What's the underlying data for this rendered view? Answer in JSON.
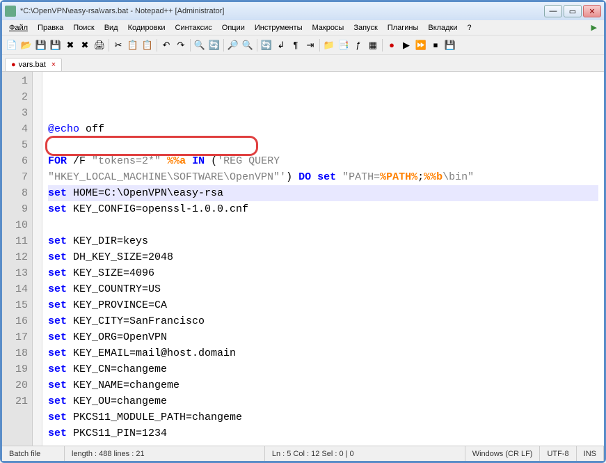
{
  "window": {
    "title": "*C:\\OpenVPN\\easy-rsa\\vars.bat - Notepad++ [Administrator]"
  },
  "menu": {
    "file": "Файл",
    "edit": "Правка",
    "search": "Поиск",
    "view": "Вид",
    "encoding": "Кодировки",
    "syntax": "Синтаксис",
    "options": "Опции",
    "tools": "Инструменты",
    "macros": "Макросы",
    "run": "Запуск",
    "plugins": "Плагины",
    "tabs": "Вкладки",
    "help": "?"
  },
  "tab": {
    "name": "vars.bat"
  },
  "code": {
    "lines": [
      {
        "n": 1,
        "t": "echoOff"
      },
      {
        "n": 2,
        "t": "blank"
      },
      {
        "n": 3,
        "t": "forLine"
      },
      {
        "n": 4,
        "t": "blank2"
      },
      {
        "n": 5,
        "t": "setHome",
        "hl": true
      },
      {
        "n": 6,
        "t": "setKeyConf"
      },
      {
        "n": 7,
        "t": "blank"
      },
      {
        "n": 8,
        "t": "setKeyDir"
      },
      {
        "n": 9,
        "t": "setDhSize"
      },
      {
        "n": 10,
        "t": "setKeySize"
      },
      {
        "n": 11,
        "t": "setCountry"
      },
      {
        "n": 12,
        "t": "setProvince"
      },
      {
        "n": 13,
        "t": "setCity"
      },
      {
        "n": 14,
        "t": "setOrg"
      },
      {
        "n": 15,
        "t": "setEmail"
      },
      {
        "n": 16,
        "t": "setCn"
      },
      {
        "n": 17,
        "t": "setName"
      },
      {
        "n": 18,
        "t": "setOu"
      },
      {
        "n": 19,
        "t": "setPkcsPath"
      },
      {
        "n": 20,
        "t": "setPkcsPin"
      },
      {
        "n": 21,
        "t": "blank"
      }
    ],
    "text": {
      "at_echo": "@echo",
      "off": " off",
      "for": "FOR",
      "for_args": " /F ",
      "for_tok": "\"tokens=2*\"",
      "for_var": " %%a ",
      "in": "IN",
      " lp": " (",
      "reg": "'REG QUERY \n\"HKEY_LOCAL_MACHINE\\SOFTWARE\\OpenVPN\"'",
      "rp": ") ",
      "do": "DO",
      " set": " set ",
      "path": "\"PATH=",
      "pathvar": "%PATH%",
      ";": ";",
      "bvar": "%%b",
      "bin": "\\bin\"",
      "set": "set",
      "home": " HOME=C:\\OpenVPN\\easy-rsa",
      "keyconf": " KEY_CONFIG=openssl-1.0.0.cnf",
      "keydir": " KEY_DIR=keys",
      "dhsize": " DH_KEY_SIZE=2048",
      "keysize": " KEY_SIZE=4096",
      "country": " KEY_COUNTRY=US",
      "province": " KEY_PROVINCE=CA",
      "city": " KEY_CITY=SanFrancisco",
      "org": " KEY_ORG=OpenVPN",
      "email": " KEY_EMAIL=mail@host.domain",
      "cn": " KEY_CN=changeme",
      "name": " KEY_NAME=changeme",
      "ou": " KEY_OU=changeme",
      "pkcspath": " PKCS11_MODULE_PATH=changeme",
      "pkcspin": " PKCS11_PIN=1234"
    }
  },
  "status": {
    "type": "Batch file",
    "length": "length : 488    lines : 21",
    "pos": "Ln : 5    Col : 12    Sel : 0 | 0",
    "eol": "Windows (CR LF)",
    "enc": "UTF-8",
    "mode": "INS"
  }
}
